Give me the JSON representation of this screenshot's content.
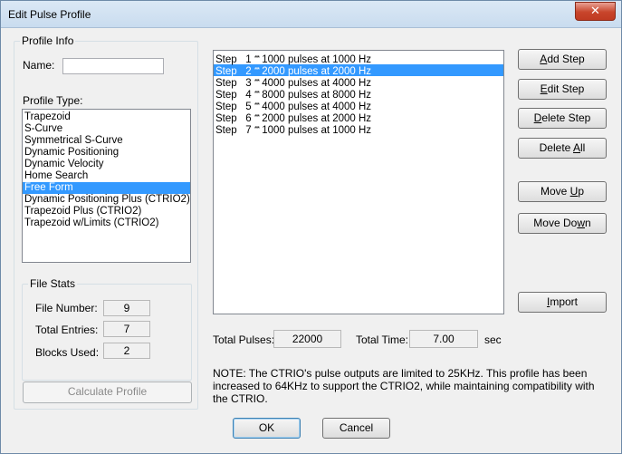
{
  "window": {
    "title": "Edit Pulse Profile",
    "close_glyph": "✕"
  },
  "profile_info": {
    "legend": "Profile Info",
    "name_label": "Name:",
    "name_value": "",
    "type_label": "Profile Type:",
    "types": [
      "Trapezoid",
      "S-Curve",
      "Symmetrical S-Curve",
      "Dynamic Positioning",
      "Dynamic Velocity",
      "Home Search",
      "Free Form",
      "Dynamic Positioning Plus (CTRIO2)",
      "Trapezoid Plus (CTRIO2)",
      "Trapezoid w/Limits (CTRIO2)"
    ],
    "selected_type_index": 6
  },
  "file_stats": {
    "legend": "File Stats",
    "file_number_label": "File Number:",
    "file_number": "9",
    "total_entries_label": "Total Entries:",
    "total_entries": "7",
    "blocks_used_label": "Blocks Used:",
    "blocks_used": "2"
  },
  "calculate_button": "Calculate Profile",
  "steps": [
    {
      "prefix": "Step   1 ",
      "stars": "***",
      "text": " 1000 pulses at 1000 Hz"
    },
    {
      "prefix": "Step   2 ",
      "stars": "***",
      "text": " 2000 pulses at 2000 Hz"
    },
    {
      "prefix": "Step   3 ",
      "stars": "***",
      "text": " 4000 pulses at 4000 Hz"
    },
    {
      "prefix": "Step   4 ",
      "stars": "***",
      "text": " 8000 pulses at 8000 Hz"
    },
    {
      "prefix": "Step   5 ",
      "stars": "***",
      "text": " 4000 pulses at 4000 Hz"
    },
    {
      "prefix": "Step   6 ",
      "stars": "***",
      "text": " 2000 pulses at 2000 Hz"
    },
    {
      "prefix": "Step   7 ",
      "stars": "***",
      "text": " 1000 pulses at 1000 Hz"
    }
  ],
  "selected_step_index": 1,
  "buttons": {
    "add_step": {
      "before": "",
      "u": "A",
      "after": "dd Step"
    },
    "edit_step": {
      "before": "",
      "u": "E",
      "after": "dit Step"
    },
    "delete_step": {
      "before": "",
      "u": "D",
      "after": "elete Step"
    },
    "delete_all": {
      "before": "Delete ",
      "u": "A",
      "after": "ll"
    },
    "move_up": {
      "before": "Move ",
      "u": "U",
      "after": "p"
    },
    "move_down": {
      "before": "Move Do",
      "u": "w",
      "after": "n"
    },
    "import": {
      "before": "",
      "u": "I",
      "after": "mport"
    },
    "ok": "OK",
    "cancel": "Cancel"
  },
  "totals": {
    "pulses_label": "Total Pulses:",
    "pulses": "22000",
    "time_label": "Total Time:",
    "time": "7.00",
    "time_unit": "sec"
  },
  "note": "NOTE: The CTRIO's pulse outputs are limited to 25KHz. This profile has been increased to 64KHz to support the CTRIO2, while maintaining compatibility with the CTRIO."
}
